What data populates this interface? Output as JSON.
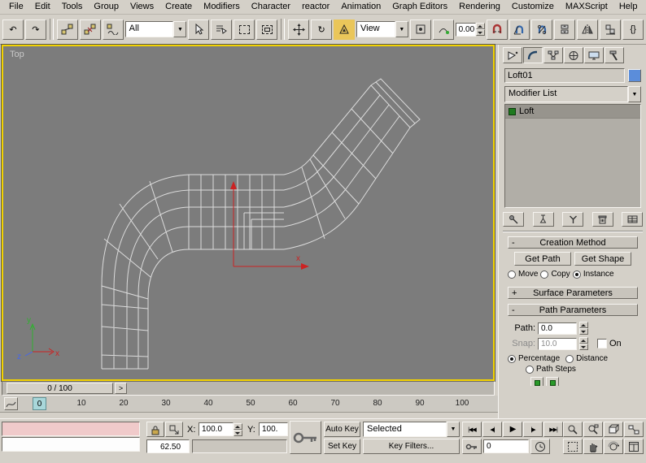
{
  "menu_bar": {
    "items": [
      "File",
      "Edit",
      "Tools",
      "Group",
      "Views",
      "Create",
      "Modifiers",
      "Character",
      "reactor",
      "Animation",
      "Graph Editors",
      "Rendering",
      "Customize",
      "MAXScript",
      "Help"
    ]
  },
  "toolbar": {
    "selection_filter_value": "All",
    "coord_system_value": "View",
    "snap_spinner_value": "0.00",
    "curly_label": "{}"
  },
  "icons": {
    "undo": "↶",
    "redo": "↷",
    "dropdown": "▼",
    "rotate": "↻",
    "play": "▶",
    "go_start": "|◀◀",
    "prev_frame": "◀|",
    "next_frame": "|▶",
    "go_end": "▶▶|",
    "slider_next": ">"
  },
  "viewport": {
    "label": "Top",
    "gizmo_x_label": "x",
    "axis": {
      "x": "x",
      "y": "y",
      "z": "z"
    }
  },
  "command_panel": {
    "object_name": "Loft01",
    "modifier_list_label": "Modifier List",
    "stack_selected": "Loft",
    "rollouts": {
      "creation_method": {
        "state": "-",
        "title": "Creation Method",
        "get_path": "Get Path",
        "get_shape": "Get Shape",
        "move": "Move",
        "copy": "Copy",
        "instance": "Instance"
      },
      "surface_parameters": {
        "state": "+",
        "title": "Surface Parameters"
      },
      "path_parameters": {
        "state": "-",
        "title": "Path Parameters",
        "path_label": "Path:",
        "path_value": "0.0",
        "snap_label": "Snap:",
        "snap_value": "10.0",
        "on_label": "On",
        "percentage": "Percentage",
        "distance": "Distance",
        "path_steps": "Path Steps"
      }
    }
  },
  "time_slider": {
    "value": "0 / 100"
  },
  "track_bar": {
    "ticks": [
      "0",
      "10",
      "20",
      "30",
      "40",
      "50",
      "60",
      "70",
      "80",
      "90",
      "100"
    ]
  },
  "status_bar": {
    "x_label": "X:",
    "x_value": "100.0",
    "y_label": "Y:",
    "y_value": "100.",
    "auto_key": "Auto Key",
    "set_key": "Set Key",
    "selection_set": "Selected",
    "key_filters": "Key Filters...",
    "frame_value": "0",
    "status_value": "62.50"
  }
}
